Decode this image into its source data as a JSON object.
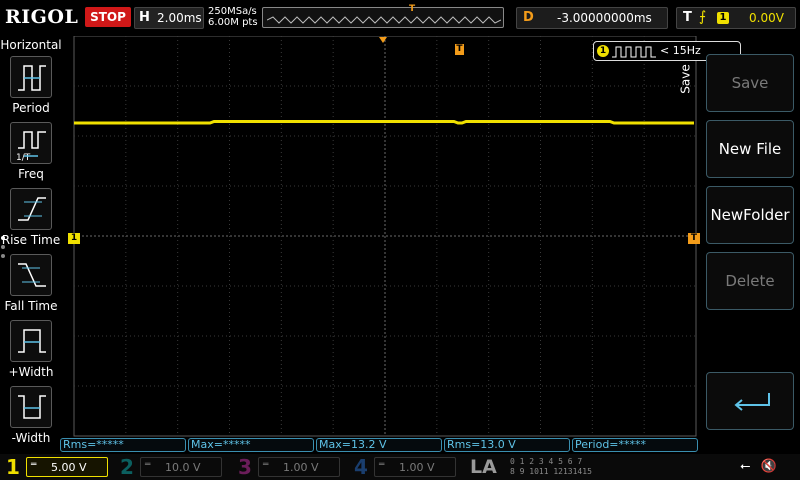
{
  "header": {
    "brand": "RIGOL",
    "run_state": "STOP",
    "horizontal_label": "H",
    "timebase": "2.00ms",
    "sample_rate": "250MSa/s",
    "memory_depth": "6.00M pts",
    "mem_trigger_marker": "T",
    "delay_label": "D",
    "delay_value": "-3.00000000ms",
    "trigger_label": "T",
    "trigger_edge": "⨍",
    "trigger_source": "1",
    "trigger_level": "0.00V"
  },
  "left_panel": {
    "title": "Horizontal",
    "items": [
      {
        "label": "Period",
        "icon": "period-icon"
      },
      {
        "label": "Freq",
        "icon": "freq-icon"
      },
      {
        "label": "Rise Time",
        "icon": "rise-time-icon"
      },
      {
        "label": "Fall Time",
        "icon": "fall-time-icon"
      },
      {
        "label": "+Width",
        "icon": "positive-width-icon"
      },
      {
        "label": "-Width",
        "icon": "negative-width-icon"
      }
    ]
  },
  "display": {
    "channel_badge": "1",
    "frequency_readout": "< 15Hz",
    "ch1_marker": "1",
    "trigger_level_marker": "T",
    "trigger_position_marker": "T"
  },
  "save_menu": {
    "tab_label": "Save",
    "buttons": [
      {
        "label": "Save",
        "enabled": false
      },
      {
        "label": "New File",
        "enabled": true
      },
      {
        "label": "NewFolder",
        "enabled": true
      },
      {
        "label": "Delete",
        "enabled": false
      }
    ],
    "enter_icon": "enter-arrow-icon"
  },
  "measurements": [
    "Rms=*****",
    "Max=*****",
    "Max=13.2 V",
    "Rms=13.0 V",
    "Period=*****"
  ],
  "channels": [
    {
      "num": "1",
      "coupling": "═",
      "scale": "5.00 V",
      "active": true
    },
    {
      "num": "2",
      "coupling": "═",
      "scale": "10.0 V",
      "active": false
    },
    {
      "num": "3",
      "coupling": "═",
      "scale": "1.00 V",
      "active": false
    },
    {
      "num": "4",
      "coupling": "═",
      "scale": "1.00 V",
      "active": false
    }
  ],
  "logic_analyzer": {
    "label": "LA",
    "digits_top": "0 1 2 3 4 5 6 7",
    "digits_bottom": "8 9 1011 12131415"
  },
  "status_icons": [
    "usb-icon",
    "speaker-muted-icon"
  ],
  "colors": {
    "ch1": "#f0e000",
    "ch2": "#0b5f5f",
    "ch3": "#6b1d5a",
    "ch4": "#1a3e6e",
    "trigger": "#f39c1a",
    "stop": "#d01818",
    "measure": "#5fc3e8"
  }
}
